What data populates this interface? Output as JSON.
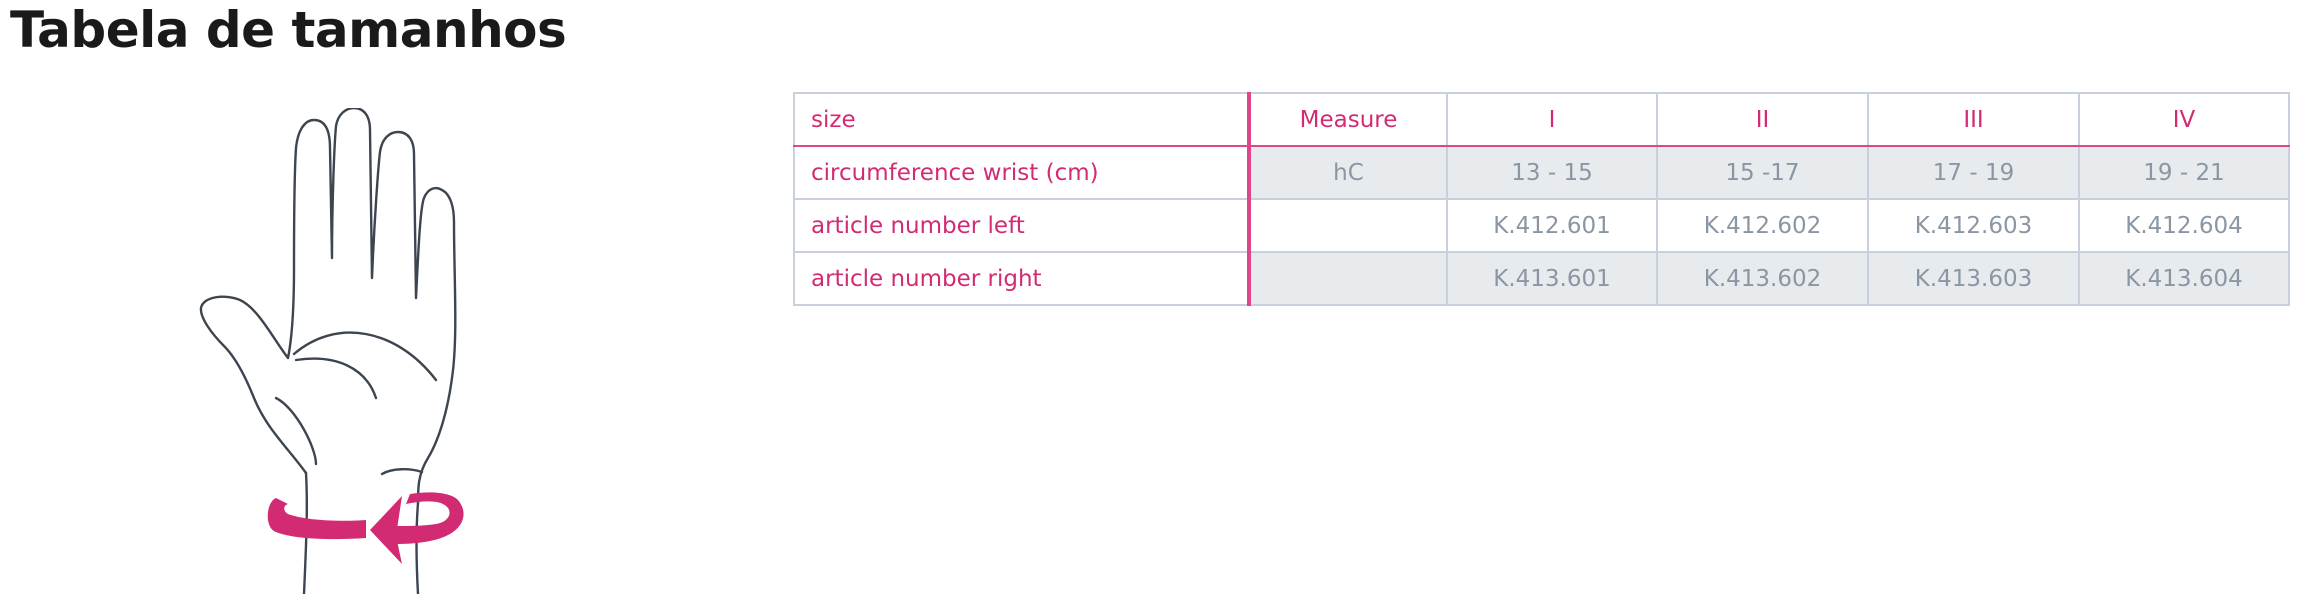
{
  "title": "Tabela de tamanhos",
  "table": {
    "header": {
      "label": "size",
      "measure": "Measure",
      "sizes": [
        "I",
        "II",
        "III",
        "IV"
      ]
    },
    "rows": [
      {
        "label": "circumference wrist (cm)",
        "measure": "hC",
        "values": [
          "13 - 15",
          "15 -17",
          "17 - 19",
          "19 - 21"
        ]
      },
      {
        "label": "article number left",
        "measure": "",
        "values": [
          "K.412.601",
          "K.412.602",
          "K.412.603",
          "K.412.604"
        ]
      },
      {
        "label": "article number right",
        "measure": "",
        "values": [
          "K.413.601",
          "K.413.602",
          "K.413.603",
          "K.413.604"
        ]
      }
    ]
  },
  "colors": {
    "accent_pink": "#d32b73",
    "value_gray": "#8a96a3",
    "shade": "#e8ebee",
    "border": "#c8d1db",
    "outline": "#3d4550"
  },
  "illustration": {
    "icon": "hand-wrist-measure-icon"
  }
}
